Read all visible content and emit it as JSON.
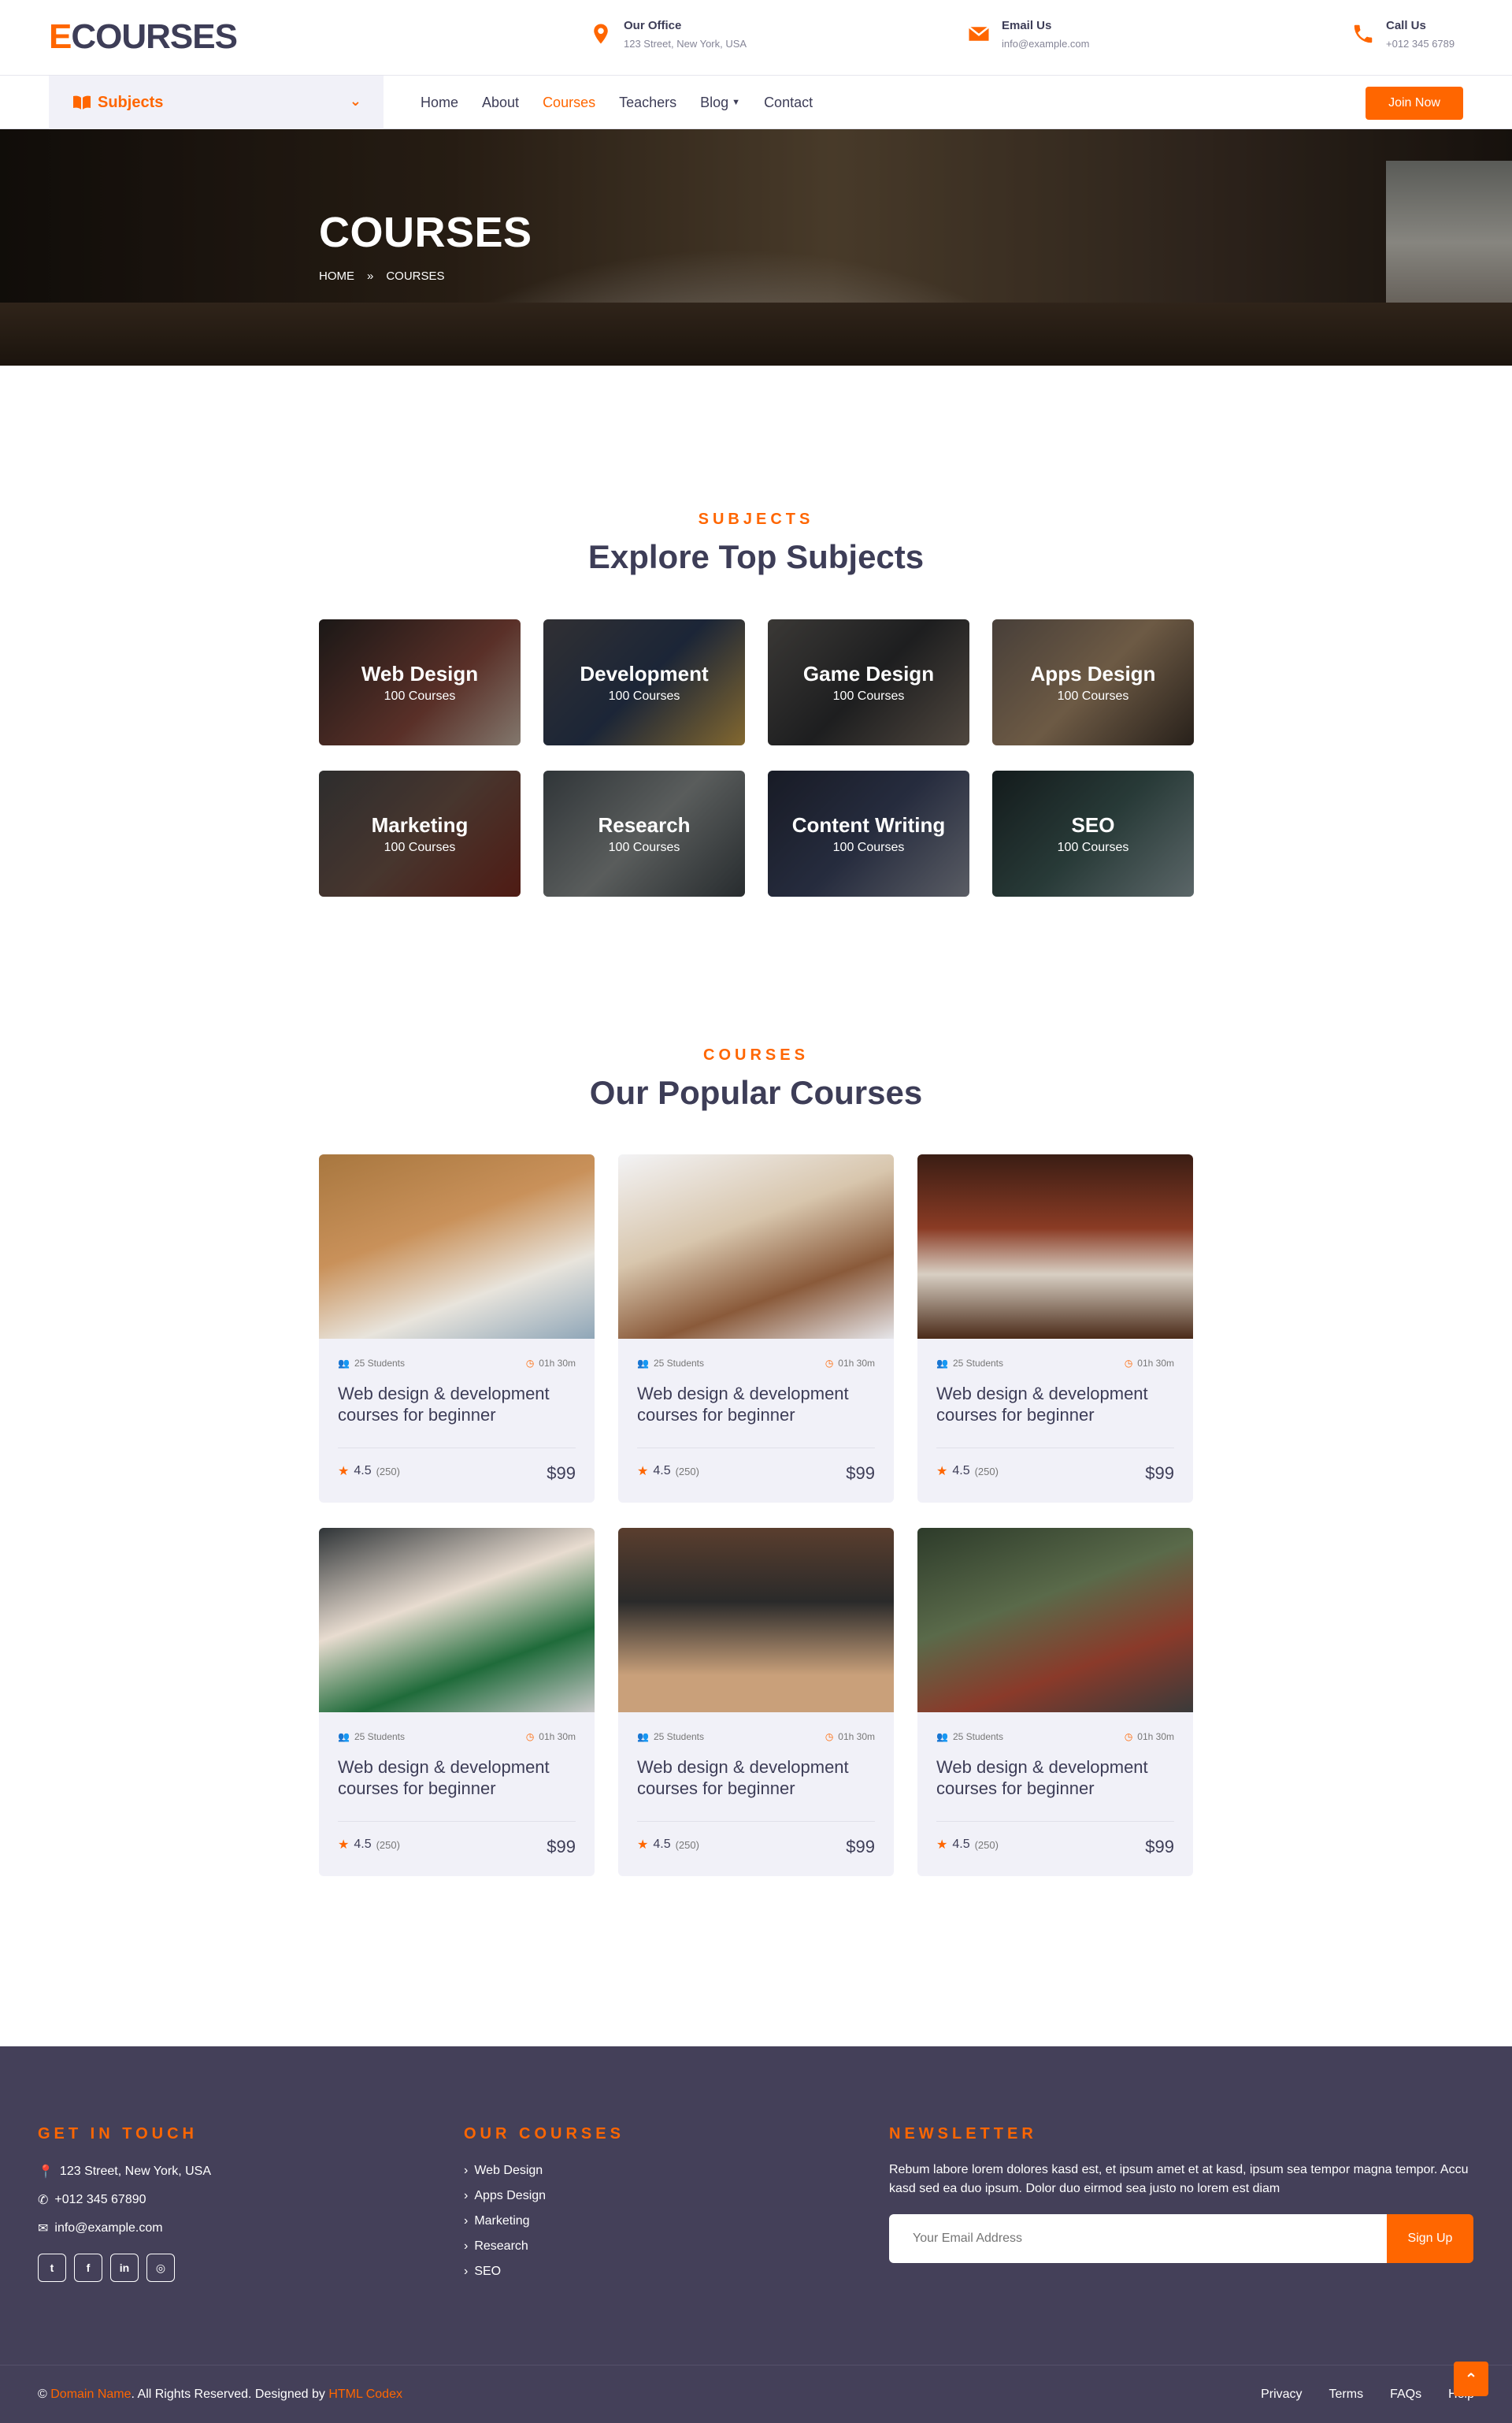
{
  "header": {
    "logo_mark": "E",
    "logo_rest": "COURSES",
    "contacts": [
      {
        "title": "Our Office",
        "value": "123 Street, New York, USA",
        "icon": "map-marker-icon"
      },
      {
        "title": "Email Us",
        "value": "info@example.com",
        "icon": "envelope-icon"
      },
      {
        "title": "Call Us",
        "value": "+012 345 6789",
        "icon": "phone-icon"
      }
    ]
  },
  "nav": {
    "subjects_label": "Subjects",
    "links": [
      "Home",
      "About",
      "Courses",
      "Teachers",
      "Blog",
      "Contact"
    ],
    "active": "Courses",
    "join_label": "Join Now"
  },
  "hero": {
    "title": "COURSES",
    "crumb_home": "HOME",
    "crumb_sep": "»",
    "crumb_current": "COURSES"
  },
  "subjects_section": {
    "kicker": "SUBJECTS",
    "title": "Explore Top Subjects",
    "items": [
      {
        "name": "Web Design",
        "count": "100 Courses"
      },
      {
        "name": "Development",
        "count": "100 Courses"
      },
      {
        "name": "Game Design",
        "count": "100 Courses"
      },
      {
        "name": "Apps Design",
        "count": "100 Courses"
      },
      {
        "name": "Marketing",
        "count": "100 Courses"
      },
      {
        "name": "Research",
        "count": "100 Courses"
      },
      {
        "name": "Content Writing",
        "count": "100 Courses"
      },
      {
        "name": "SEO",
        "count": "100 Courses"
      }
    ]
  },
  "courses_section": {
    "kicker": "COURSES",
    "title": "Our Popular Courses",
    "items": [
      {
        "students": "25 Students",
        "duration": "01h 30m",
        "title": "Web design & development courses for beginner",
        "rating": "4.5",
        "reviews": "(250)",
        "price": "$99"
      },
      {
        "students": "25 Students",
        "duration": "01h 30m",
        "title": "Web design & development courses for beginner",
        "rating": "4.5",
        "reviews": "(250)",
        "price": "$99"
      },
      {
        "students": "25 Students",
        "duration": "01h 30m",
        "title": "Web design & development courses for beginner",
        "rating": "4.5",
        "reviews": "(250)",
        "price": "$99"
      },
      {
        "students": "25 Students",
        "duration": "01h 30m",
        "title": "Web design & development courses for beginner",
        "rating": "4.5",
        "reviews": "(250)",
        "price": "$99"
      },
      {
        "students": "25 Students",
        "duration": "01h 30m",
        "title": "Web design & development courses for beginner",
        "rating": "4.5",
        "reviews": "(250)",
        "price": "$99"
      },
      {
        "students": "25 Students",
        "duration": "01h 30m",
        "title": "Web design & development courses for beginner",
        "rating": "4.5",
        "reviews": "(250)",
        "price": "$99"
      }
    ]
  },
  "footer": {
    "contact_head": "GET IN TOUCH",
    "address": "123 Street, New York, USA",
    "phone": "+012 345 67890",
    "email": "info@example.com",
    "social": [
      "twitter-icon",
      "facebook-icon",
      "linkedin-icon",
      "instagram-icon"
    ],
    "courses_head": "OUR COURSES",
    "courses": [
      "Web Design",
      "Apps Design",
      "Marketing",
      "Research",
      "SEO"
    ],
    "news_head": "NEWSLETTER",
    "news_text": "Rebum labore lorem dolores kasd est, et ipsum amet et at kasd, ipsum sea tempor magna tempor. Accu kasd sed ea duo ipsum. Dolor duo eirmod sea justo no lorem est diam",
    "news_placeholder": "Your Email Address",
    "news_button": "Sign Up",
    "copy_symbol": "©",
    "domain": "Domain Name",
    "rights": ". All Rights Reserved. Designed by ",
    "designer": "HTML Codex",
    "bottom_links": [
      "Privacy",
      "Terms",
      "FAQs",
      "Help"
    ]
  },
  "colors": {
    "accent": "#ff6600",
    "dark": "#3d3d57",
    "footer": "#444059",
    "card": "#f1f1f8"
  }
}
